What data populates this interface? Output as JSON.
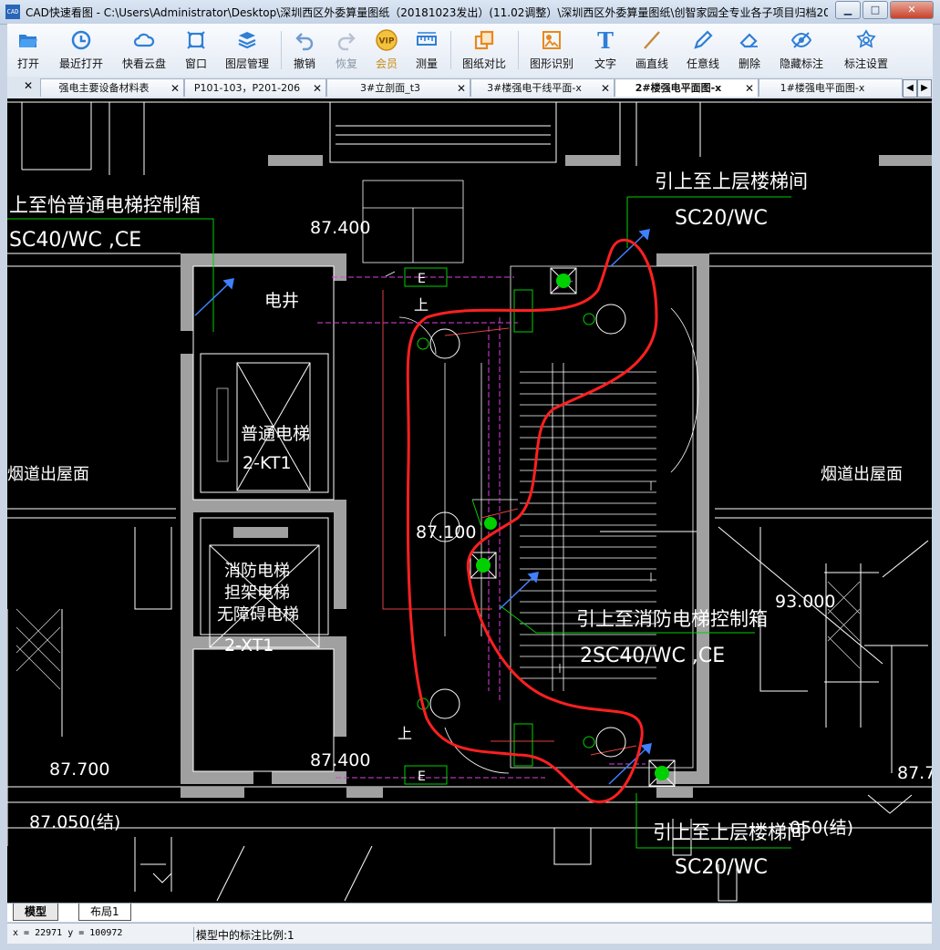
{
  "window": {
    "title": "CAD快速看图 - C:\\Users\\Administrator\\Desktop\\深圳西区外委算量图纸（20181023发出）(11.02调整）\\深圳西区外委算量图纸\\创智家园全专业各子项目归档201...",
    "app_icon_text": "CAD",
    "minimize": "▁",
    "maximize": "□",
    "close": "✕"
  },
  "toolbar": {
    "buttons": [
      {
        "label": "打开",
        "icon": "folder-open-icon"
      },
      {
        "label": "最近打开",
        "icon": "clock-icon"
      },
      {
        "label": "快看云盘",
        "icon": "cloud-icon"
      },
      {
        "label": "窗口",
        "icon": "window-icon"
      },
      {
        "label": "图层管理",
        "icon": "layers-icon"
      },
      {
        "label": "撤销",
        "icon": "undo-icon"
      },
      {
        "label": "恢复",
        "icon": "redo-icon"
      },
      {
        "label": "会员",
        "icon": "vip-icon",
        "badge": "VIP"
      },
      {
        "label": "测量",
        "icon": "ruler-icon"
      },
      {
        "label": "图纸对比",
        "icon": "compare-icon"
      },
      {
        "label": "图形识别",
        "icon": "shape-recognition-icon"
      },
      {
        "label": "文字",
        "icon": "text-icon",
        "glyph": "T"
      },
      {
        "label": "画直线",
        "icon": "line-icon"
      },
      {
        "label": "任意线",
        "icon": "pencil-icon"
      },
      {
        "label": "删除",
        "icon": "eraser-icon"
      },
      {
        "label": "隐藏标注",
        "icon": "eye-hidden-icon"
      },
      {
        "label": "标注设置",
        "icon": "settings-icon"
      }
    ]
  },
  "tabs": [
    {
      "label": "强电主要设备材料表",
      "active": false
    },
    {
      "label": "P101-103，P201-206",
      "active": false
    },
    {
      "label": "3#立剖面_t3",
      "active": false
    },
    {
      "label": "3#楼强电干线平面-x",
      "active": false
    },
    {
      "label": "2#楼强电平面图-x",
      "active": true
    },
    {
      "label": "1#楼强电平面图-x",
      "active": false
    }
  ],
  "tab_close": "✕",
  "tab_nav": {
    "prev": "◀",
    "next": "▶"
  },
  "drawing": {
    "labels": {
      "riser_top_left": "上至怡普通电梯控制箱",
      "cable_top_left": "SC40/WC ,CE",
      "level_top": "87.400",
      "well": "电井",
      "stair_up_top": "上",
      "riser_top_right": "引上至上层楼梯间",
      "cable_top_right": "SC20/WC",
      "elevator_normal_1": "普通电梯",
      "elevator_normal_2": "2-KT1",
      "shaft_left": "烟道出屋面",
      "shaft_right": "烟道出屋面",
      "level_mid": "87.100",
      "elevator_fire_1": "消防电梯",
      "elevator_fire_2": "担架电梯",
      "elevator_fire_3": "无障碍电梯",
      "elevator_fire_4": "2-XT1",
      "level_right": "93.000",
      "riser_fire": "引上至消防电梯控制箱",
      "cable_fire": "2SC40/WC ,CE",
      "level_bottom_left": "87.700",
      "level_bottom_mid": "87.400",
      "level_bottom_right": "87.7",
      "level_struct_left": "87.050(结)",
      "level_struct_right": "050(结)",
      "stair_up_bottom": "上",
      "riser_bottom_right": "引上至上层楼梯间",
      "cable_bottom_right": "SC20/WC",
      "box_e": "E"
    }
  },
  "bottom_tabs": [
    {
      "label": "模型",
      "active": true
    },
    {
      "label": "布局1",
      "active": false
    }
  ],
  "status": {
    "coordinates": "x = 22971  y = 100972",
    "scale_text": "模型中的标注比例:1"
  }
}
